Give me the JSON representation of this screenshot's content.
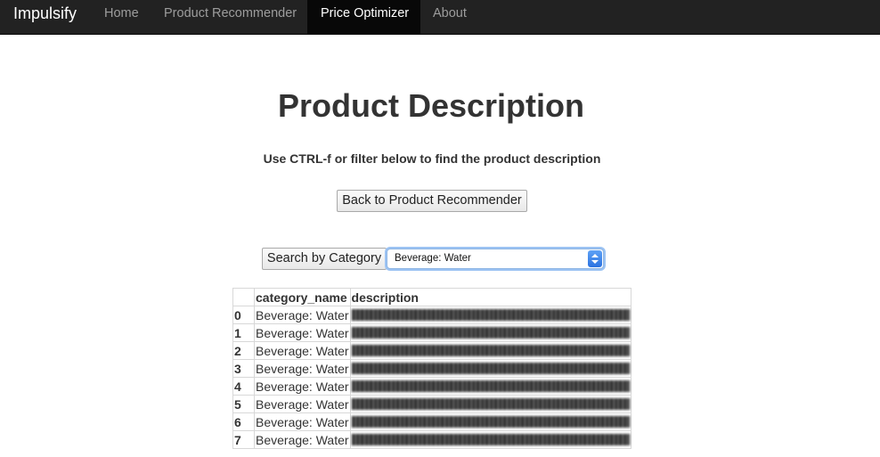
{
  "navbar": {
    "brand": "Impulsify",
    "items": [
      {
        "label": "Home",
        "active": false
      },
      {
        "label": "Product Recommender",
        "active": false
      },
      {
        "label": "Price Optimizer",
        "active": true
      },
      {
        "label": "About",
        "active": false
      }
    ]
  },
  "main": {
    "title": "Product Description",
    "subtitle": "Use CTRL-f or filter below to find the product description",
    "back_button_label": "Back to Product Recommender",
    "search_button_label": "Search by Category",
    "category_select_value": "Beverage: Water"
  },
  "table": {
    "columns": [
      "",
      "category_name",
      "description"
    ],
    "rows": [
      {
        "index": "0",
        "category_name": "Beverage: Water"
      },
      {
        "index": "1",
        "category_name": "Beverage: Water"
      },
      {
        "index": "2",
        "category_name": "Beverage: Water"
      },
      {
        "index": "3",
        "category_name": "Beverage: Water"
      },
      {
        "index": "4",
        "category_name": "Beverage: Water"
      },
      {
        "index": "5",
        "category_name": "Beverage: Water"
      },
      {
        "index": "6",
        "category_name": "Beverage: Water"
      },
      {
        "index": "7",
        "category_name": "Beverage: Water"
      }
    ]
  },
  "colors": {
    "navbar_bg": "#222222",
    "navbar_active_bg": "#080808",
    "nav_text": "#9d9d9d",
    "select_focus": "#9cc3f3"
  }
}
